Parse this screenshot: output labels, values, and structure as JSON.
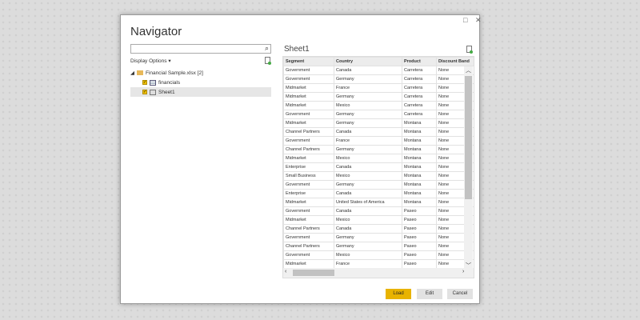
{
  "window": {
    "title": "Navigator",
    "maximize_icon": "□",
    "close_icon": "✕"
  },
  "left": {
    "search_placeholder": "",
    "search_icon": "⌕",
    "display_options": "Display Options",
    "dropdown_icon": "▾",
    "tree": [
      {
        "label": "Financial Sample.xlsx [2]",
        "type": "folder"
      },
      {
        "label": "financials",
        "type": "table",
        "checked": true
      },
      {
        "label": "Sheet1",
        "type": "sheet",
        "checked": true,
        "selected": true
      }
    ]
  },
  "preview": {
    "title": "Sheet1",
    "columns": [
      "Segment",
      "Country",
      "Product",
      "Discount Band"
    ],
    "rows": [
      [
        "Government",
        "Canada",
        "Carretera",
        "None"
      ],
      [
        "Government",
        "Germany",
        "Carretera",
        "None"
      ],
      [
        "Midmarket",
        "France",
        "Carretera",
        "None"
      ],
      [
        "Midmarket",
        "Germany",
        "Carretera",
        "None"
      ],
      [
        "Midmarket",
        "Mexico",
        "Carretera",
        "None"
      ],
      [
        "Government",
        "Germany",
        "Carretera",
        "None"
      ],
      [
        "Midmarket",
        "Germany",
        "Montana",
        "None"
      ],
      [
        "Channel Partners",
        "Canada",
        "Montana",
        "None"
      ],
      [
        "Government",
        "France",
        "Montana",
        "None"
      ],
      [
        "Channel Partners",
        "Germany",
        "Montana",
        "None"
      ],
      [
        "Midmarket",
        "Mexico",
        "Montana",
        "None"
      ],
      [
        "Enterprise",
        "Canada",
        "Montana",
        "None"
      ],
      [
        "Small Business",
        "Mexico",
        "Montana",
        "None"
      ],
      [
        "Government",
        "Germany",
        "Montana",
        "None"
      ],
      [
        "Enterprise",
        "Canada",
        "Montana",
        "None"
      ],
      [
        "Midmarket",
        "United States of America",
        "Montana",
        "None"
      ],
      [
        "Government",
        "Canada",
        "Paseo",
        "None"
      ],
      [
        "Midmarket",
        "Mexico",
        "Paseo",
        "None"
      ],
      [
        "Channel Partners",
        "Canada",
        "Paseo",
        "None"
      ],
      [
        "Government",
        "Germany",
        "Paseo",
        "None"
      ],
      [
        "Channel Partners",
        "Germany",
        "Paseo",
        "None"
      ],
      [
        "Government",
        "Mexico",
        "Paseo",
        "None"
      ],
      [
        "Midmarket",
        "France",
        "Paseo",
        "None"
      ]
    ]
  },
  "buttons": {
    "load": "Load",
    "edit": "Edit",
    "cancel": "Cancel"
  },
  "colors": {
    "accent": "#e8b300"
  }
}
